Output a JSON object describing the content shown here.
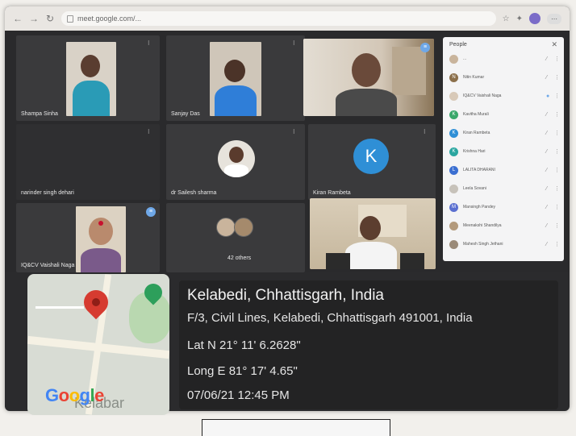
{
  "browser": {
    "url": "meet.google.com/..."
  },
  "meeting": {
    "tiles": [
      {
        "name": "Shampa Sinha"
      },
      {
        "name": "Sanjay Das"
      },
      {
        "name": "narinder singh dehari"
      },
      {
        "name": "dr Sailesh sharma"
      },
      {
        "name": "Kiran Rambeta"
      },
      {
        "name": "IQ&CV Vaishali Naga"
      },
      {
        "name": "42 others"
      }
    ],
    "avatar_letter": "K"
  },
  "people_panel": {
    "title": "People",
    "rows": [
      {
        "name": "...",
        "avatar_letter": "",
        "color": "#c9b49c"
      },
      {
        "name": "Nitin Kumar",
        "avatar_letter": "N",
        "color": "#8b6f4a"
      },
      {
        "name": "IQ&CV Vaishali Naga",
        "avatar_letter": "",
        "color": "#d8c9b8"
      },
      {
        "name": "Kavitha Murali",
        "avatar_letter": "K",
        "color": "#3aa86b"
      },
      {
        "name": "Kiran Rambeta",
        "avatar_letter": "K",
        "color": "#2f8fd6"
      },
      {
        "name": "Krishna Hari",
        "avatar_letter": "K",
        "color": "#2aa6a0"
      },
      {
        "name": "LALITA DHARANI",
        "avatar_letter": "L",
        "color": "#3b6fd1"
      },
      {
        "name": "Leela Sovani",
        "avatar_letter": "",
        "color": "#c7c2ba"
      },
      {
        "name": "Mansingh Pandey",
        "avatar_letter": "M",
        "color": "#5a6fd0"
      },
      {
        "name": "Meenakshi Shandilya",
        "avatar_letter": "",
        "color": "#b39a7c"
      },
      {
        "name": "Mahesh Singh Jethani",
        "avatar_letter": "",
        "color": "#9a8a78"
      }
    ]
  },
  "geotag": {
    "title": "Kelabedi, Chhattisgarh, India",
    "address": "F/3, Civil Lines, Kelabedi, Chhattisgarh 491001, India",
    "lat": "Lat N 21° 11' 6.2628\"",
    "long": "Long E 81° 17' 4.65\"",
    "datetime": "07/06/21 12:45 PM",
    "map_logo": "Google",
    "map_place_label": "Kelabar"
  },
  "colors": {
    "google_blue": "#4285f4",
    "google_red": "#ea4335",
    "google_yellow": "#fbbc05",
    "google_green": "#34a853"
  }
}
